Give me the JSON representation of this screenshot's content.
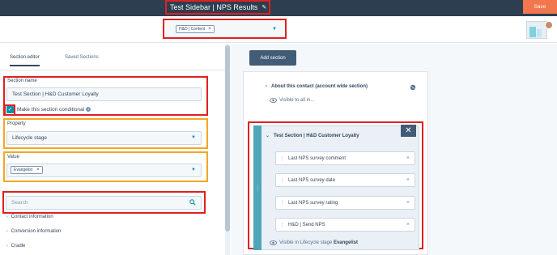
{
  "app": {
    "title": "Test Sidebar | NPS Results",
    "save_label": "Save"
  },
  "filter": {
    "tag": "H&D | Content",
    "remove_glyph": "×",
    "caret_glyph": "▼"
  },
  "tabs": [
    {
      "label": "Section editor",
      "active": true
    },
    {
      "label": "Saved Sections",
      "active": false
    }
  ],
  "editor": {
    "section_name_label": "Section name",
    "section_name_value": "Test Section | H&D Customer Loyalty",
    "conditional_label": "Make this section conditional",
    "conditional_checked": true,
    "property_label": "Property",
    "property_value": "Lifecycle stage",
    "value_label": "Value",
    "value_tag": "Evangelist",
    "search_placeholder": "Search",
    "property_groups": [
      "Contact information",
      "Conversion information",
      "Cradle"
    ]
  },
  "canvas": {
    "add_section_label": "Add section",
    "about_section": {
      "title": "About this contact (account wide section)",
      "visibility": "Visible to all in..."
    },
    "test_section": {
      "title": "Test Section | H&D Customer Loyalty",
      "close_glyph": "✕",
      "properties": [
        "Last NPS survey comment",
        "Last NPS survey date",
        "Last NPS survey rating",
        "H&D | Send NPS"
      ],
      "visibility_prefix": "Visible in Lifecycle stage",
      "visibility_value": "Evangelist"
    }
  },
  "colors": {
    "topbar": "#2d3e50",
    "save_button": "#f2774f",
    "accent": "#0091ae",
    "highlight_red": "#e02020",
    "highlight_orange": "#f5a623",
    "section_handle": "#4fa6b8"
  }
}
